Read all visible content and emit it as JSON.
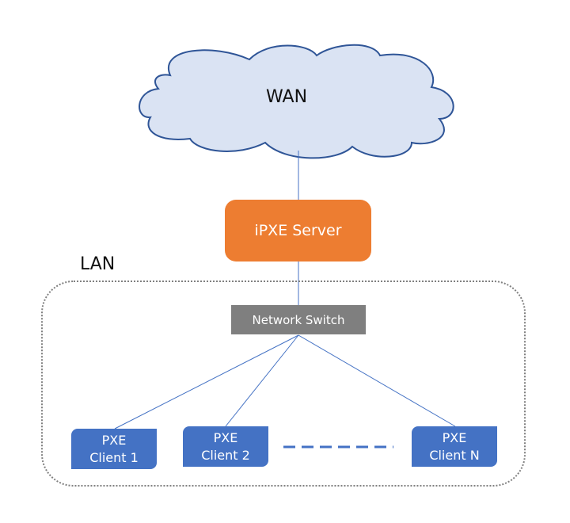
{
  "diagram": {
    "wan": {
      "label": "WAN",
      "fill": "#DAE3F3",
      "stroke": "#2F5597"
    },
    "server": {
      "label": "iPXE Server",
      "fill": "#ED7D31"
    },
    "lan": {
      "label": "LAN"
    },
    "switch": {
      "label": "Network Switch",
      "fill": "#7F7F7F"
    },
    "clients": [
      {
        "line1": "PXE",
        "line2": "Client 1"
      },
      {
        "line1": "PXE",
        "line2": "Client 2"
      },
      {
        "line1": "PXE",
        "line2": "Client N"
      }
    ],
    "client_fill": "#4472C4",
    "connector_color": "#4472C4"
  }
}
